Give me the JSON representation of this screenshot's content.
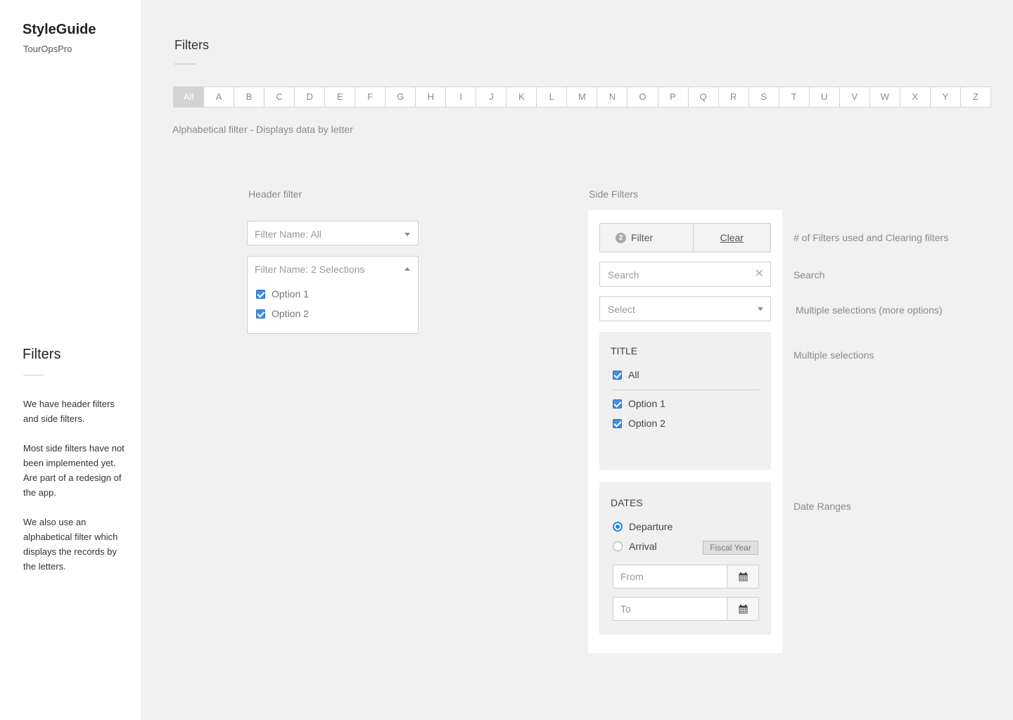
{
  "sidebar": {
    "brand": "StyleGuide",
    "brand_sub": "TourOpsPro",
    "heading": "Filters",
    "para1": "We have header filters and side filters.",
    "para2": "Most side filters have not been implemented yet. Are part of a redesign of the app.",
    "para3": "We also use an alphabetical filter which displays the records by the letters."
  },
  "main": {
    "title": "Filters",
    "alphabet": [
      "All",
      "A",
      "B",
      "C",
      "D",
      "E",
      "F",
      "G",
      "H",
      "I",
      "J",
      "K",
      "L",
      "M",
      "N",
      "O",
      "P",
      "Q",
      "R",
      "S",
      "T",
      "U",
      "V",
      "W",
      "X",
      "Y",
      "Z"
    ],
    "alpha_caption": "Alphabetical filter - Displays data by letter",
    "header_filter_label": "Header filter",
    "side_filters_label": "Side Filters"
  },
  "header_filter": {
    "dropdown1": "Filter Name: All",
    "dropdown2": "Filter Name: 2 Selections",
    "options": [
      "Option 1",
      "Option 2"
    ]
  },
  "side_filters": {
    "badge": "2",
    "filter_label": "Filter",
    "clear_label": "Clear",
    "search_placeholder": "Search",
    "select_placeholder": "Select",
    "title_card": {
      "heading": "TITLE",
      "all": "All",
      "options": [
        "Option 1",
        "Option 2"
      ]
    },
    "dates_card": {
      "heading": "DATES",
      "departure": "Departure",
      "arrival": "Arrival",
      "fiscal_year": "Fiscal Year",
      "from": "From",
      "to": "To"
    }
  },
  "notes": {
    "filters_used": "# of Filters used and Clearing filters",
    "search": "Search",
    "multi_more": "Multiple selections (more options)",
    "multi": "Multiple selections",
    "date_ranges": "Date Ranges"
  },
  "colors": {
    "accent": "#1e88e5",
    "background": "#f1f1f1",
    "panel": "#ffffff"
  },
  "icons": [
    "caret-down-icon",
    "caret-up-icon",
    "checkbox-checked-icon",
    "clear-x-icon",
    "calendar-icon",
    "radio-selected-icon",
    "radio-unselected-icon"
  ]
}
